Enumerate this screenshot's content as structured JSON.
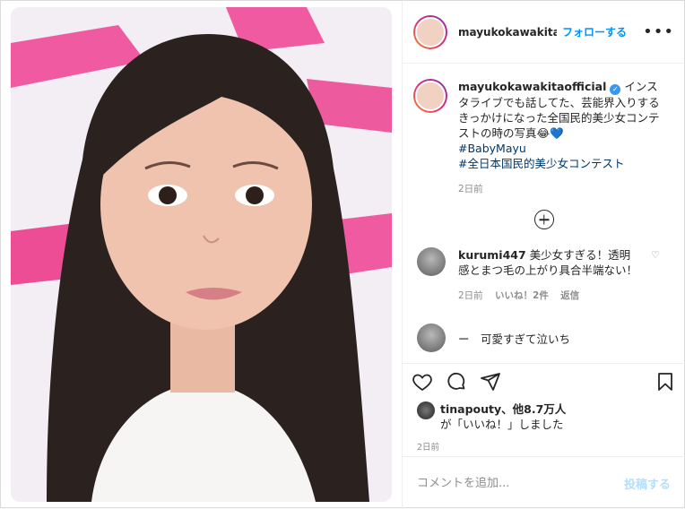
{
  "header": {
    "username": "mayukokawakitaofficial",
    "follow_label": "フォローする",
    "more_label": "•••"
  },
  "caption": {
    "username": "mayukokawakitaofficial",
    "verified_mark": "✓",
    "text": "インスタライブでも話してた、芸能界入りするきっかけになった全国民的美少女コンテストの時の写真😂💙",
    "hashtags": [
      "#BabyMayu",
      "#全日本国民的美少女コンテスト"
    ],
    "time": "2日前"
  },
  "comments": [
    {
      "username": "kurumi447",
      "text": "美少女すぎる！透明感とまつ毛の上がり具合半端ない！",
      "time": "2日前",
      "likes": "いいね！2件",
      "reply": "返信"
    }
  ],
  "partial_comment": "ー　可愛すぎて泣いち",
  "likes": {
    "user": "tinapouty",
    "others": "、他8.7万人",
    "suffix": "が「いいね！」しました"
  },
  "post_time": "2日前",
  "add_comment": {
    "placeholder": "コメントを追加...",
    "post_label": "投稿する"
  }
}
